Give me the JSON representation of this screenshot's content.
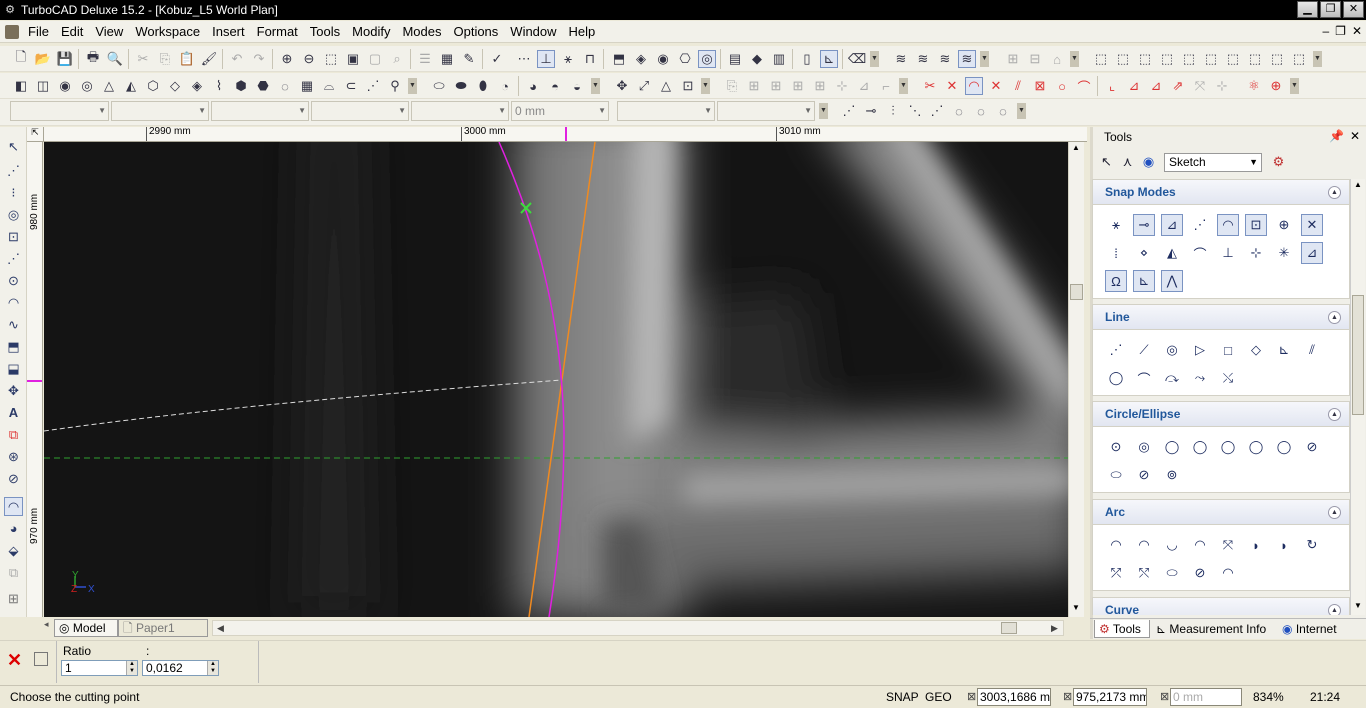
{
  "window": {
    "title": "TurboCAD Deluxe 15.2 - [Kobuz_L5 World Plan]",
    "minimize": "▁",
    "restore": "❐",
    "close": "✕"
  },
  "menu": {
    "items": [
      "File",
      "Edit",
      "View",
      "Workspace",
      "Insert",
      "Format",
      "Tools",
      "Modify",
      "Modes",
      "Options",
      "Window",
      "Help"
    ],
    "mdi_minimize": "–",
    "mdi_restore": "❐",
    "mdi_close": "✕"
  },
  "property_bar": {
    "thickness_value": "0 mm"
  },
  "rulers": {
    "top": [
      "2990 mm",
      "3000 mm",
      "3010 mm"
    ],
    "left": [
      "980 mm",
      "970 mm"
    ]
  },
  "canvas": {
    "axis_y": "Y",
    "axis_z": "Z",
    "axis_x": "X"
  },
  "sheet_tabs": {
    "model": "Model",
    "paper": "Paper1"
  },
  "inspector": {
    "ratio_label": "Ratio",
    "colon_label": ":",
    "ratio_left": "1",
    "ratio_right": "0,0162"
  },
  "status": {
    "prompt": "Choose the cutting point",
    "snap": "SNAP",
    "geo": "GEO",
    "x_value": "3003,1686 mm",
    "y_value": "975,2173 mm",
    "z_placeholder": "0 mm",
    "zoom": "834%",
    "time": "21:24"
  },
  "palette": {
    "title": "Tools",
    "mode": "Sketch",
    "sections": {
      "snap": "Snap Modes",
      "line": "Line",
      "circle": "Circle/Ellipse",
      "arc": "Arc",
      "curve": "Curve"
    },
    "tabs": {
      "tools": "Tools",
      "measurement": "Measurement Info",
      "internet": "Internet"
    }
  },
  "colors": {
    "magenta_curve": "#e020e0",
    "orange_line": "#f08a20",
    "green_guide": "#2fa02f",
    "marker": "#3cdc3c"
  }
}
